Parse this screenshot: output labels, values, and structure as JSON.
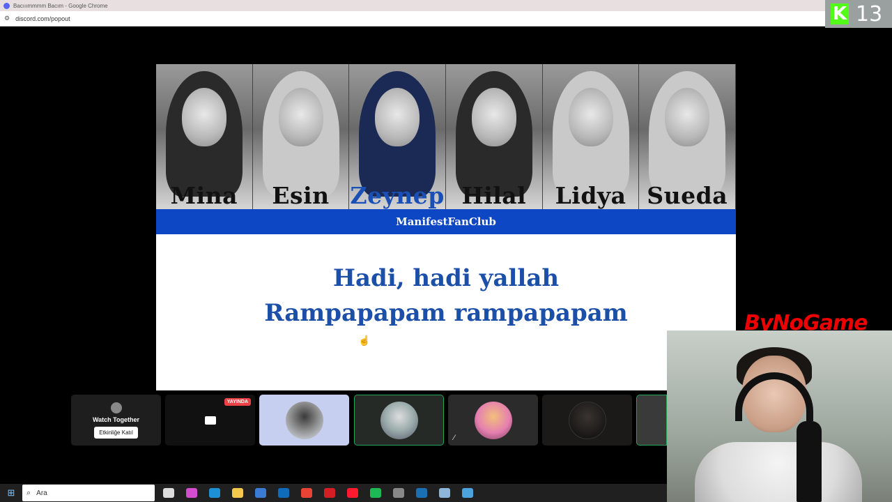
{
  "window": {
    "title": "Bacııımmmm Bacım - Google Chrome",
    "url": "discord.com/popout"
  },
  "overlay_badge": {
    "letter": "K",
    "number": "13"
  },
  "shared_screen": {
    "names": [
      "Mina",
      "Esin",
      "Zeynep",
      "Hilal",
      "Lidya",
      "Sueda"
    ],
    "banner": "ManifestFanClub",
    "lyrics_line1": "Hadi, hadi yallah",
    "lyrics_line2": "Rampapapam rampapapam"
  },
  "participants": {
    "watch_together_label": "Watch Together",
    "watch_together_button": "Etkinliğe Katıl",
    "live_badge": "YAYINDA"
  },
  "webcam": {
    "brand": "ByNoGame"
  },
  "taskbar": {
    "search_label": "Ara"
  },
  "colors": {
    "banner_blue": "#0d47c4",
    "lyrics_blue": "#1c4fa8",
    "live_red": "#ed4245",
    "speaking_green": "#23a55a",
    "kick_green": "#53fc18"
  }
}
